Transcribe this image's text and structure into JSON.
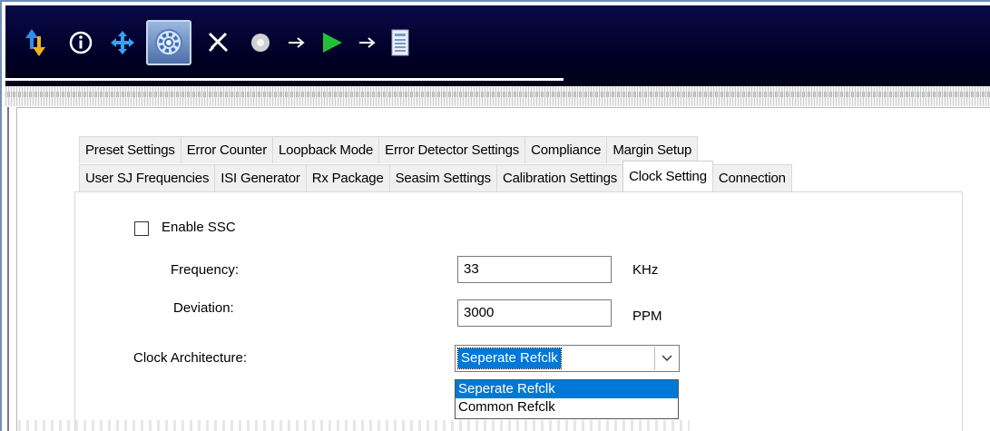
{
  "toolbar": {
    "buttons": [
      {
        "name": "transfer-icon"
      },
      {
        "name": "info-icon"
      },
      {
        "name": "move-icon"
      },
      {
        "name": "settings-gear-icon",
        "active": true
      },
      {
        "name": "tools-icon"
      },
      {
        "name": "power-icon"
      },
      {
        "name": "arrow-right-icon"
      },
      {
        "name": "play-icon"
      },
      {
        "name": "arrow-right-icon"
      },
      {
        "name": "report-icon"
      }
    ]
  },
  "tabs": {
    "row1": [
      "Preset Settings",
      "Error Counter",
      "Loopback Mode",
      "Error Detector Settings",
      "Compliance",
      "Margin Setup"
    ],
    "row2": [
      "User SJ Frequencies",
      "ISI Generator",
      "Rx Package",
      "Seasim Settings",
      "Calibration Settings",
      "Clock Setting",
      "Connection"
    ],
    "selected": "Clock Setting"
  },
  "clock_setting": {
    "enable_ssc_label": "Enable SSC",
    "enable_ssc_checked": false,
    "frequency_label": "Frequency:",
    "frequency_value": "33",
    "frequency_unit": "KHz",
    "deviation_label": "Deviation:",
    "deviation_value": "3000",
    "deviation_unit": "PPM",
    "clock_architecture_label": "Clock Architecture:",
    "clock_architecture_value": "Seperate Refclk",
    "clock_architecture_options": [
      "Seperate Refclk",
      "Common Refclk"
    ]
  },
  "colors": {
    "toolbar_bg": "#000026",
    "selection_blue": "#0078d7"
  }
}
